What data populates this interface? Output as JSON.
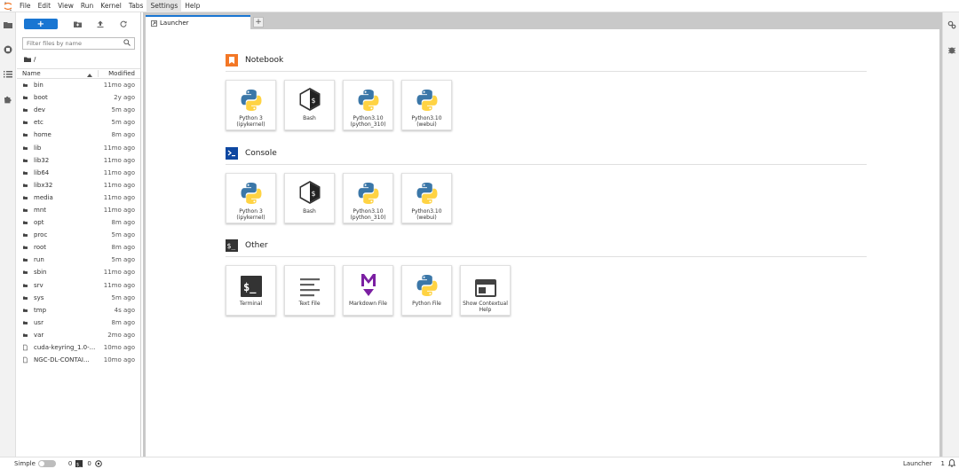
{
  "menubar": {
    "items": [
      "File",
      "Edit",
      "View",
      "Run",
      "Kernel",
      "Tabs",
      "Settings",
      "Help"
    ],
    "active": "Settings"
  },
  "filebrowser": {
    "new_label": "+",
    "filter_placeholder": "Filter files by name",
    "breadcrumb": "/",
    "col_name": "Name",
    "col_modified": "Modified",
    "items": [
      {
        "name": "bin",
        "modified": "11mo ago",
        "type": "folder"
      },
      {
        "name": "boot",
        "modified": "2y ago",
        "type": "folder"
      },
      {
        "name": "dev",
        "modified": "5m ago",
        "type": "folder"
      },
      {
        "name": "etc",
        "modified": "5m ago",
        "type": "folder"
      },
      {
        "name": "home",
        "modified": "8m ago",
        "type": "folder"
      },
      {
        "name": "lib",
        "modified": "11mo ago",
        "type": "folder"
      },
      {
        "name": "lib32",
        "modified": "11mo ago",
        "type": "folder"
      },
      {
        "name": "lib64",
        "modified": "11mo ago",
        "type": "folder"
      },
      {
        "name": "libx32",
        "modified": "11mo ago",
        "type": "folder"
      },
      {
        "name": "media",
        "modified": "11mo ago",
        "type": "folder"
      },
      {
        "name": "mnt",
        "modified": "11mo ago",
        "type": "folder"
      },
      {
        "name": "opt",
        "modified": "8m ago",
        "type": "folder"
      },
      {
        "name": "proc",
        "modified": "5m ago",
        "type": "folder"
      },
      {
        "name": "root",
        "modified": "8m ago",
        "type": "folder"
      },
      {
        "name": "run",
        "modified": "5m ago",
        "type": "folder"
      },
      {
        "name": "sbin",
        "modified": "11mo ago",
        "type": "folder"
      },
      {
        "name": "srv",
        "modified": "11mo ago",
        "type": "folder"
      },
      {
        "name": "sys",
        "modified": "5m ago",
        "type": "folder"
      },
      {
        "name": "tmp",
        "modified": "4s ago",
        "type": "folder"
      },
      {
        "name": "usr",
        "modified": "8m ago",
        "type": "folder"
      },
      {
        "name": "var",
        "modified": "2mo ago",
        "type": "folder"
      },
      {
        "name": "cuda-keyring_1.0-...",
        "modified": "10mo ago",
        "type": "file"
      },
      {
        "name": "NGC-DL-CONTAI...",
        "modified": "10mo ago",
        "type": "file"
      }
    ]
  },
  "tab": {
    "label": "Launcher",
    "add_label": "+"
  },
  "launcher": {
    "notebook": {
      "title": "Notebook",
      "cards": [
        {
          "label": "Python 3 (ipykernel)",
          "icon": "python-icon"
        },
        {
          "label": "Bash",
          "icon": "bash-icon"
        },
        {
          "label": "Python3.10 (python_310)",
          "icon": "python-icon"
        },
        {
          "label": "Python3.10 (webui)",
          "icon": "python-icon"
        }
      ]
    },
    "console": {
      "title": "Console",
      "cards": [
        {
          "label": "Python 3 (ipykernel)",
          "icon": "python-icon"
        },
        {
          "label": "Bash",
          "icon": "bash-icon"
        },
        {
          "label": "Python3.10 (python_310)",
          "icon": "python-icon"
        },
        {
          "label": "Python3.10 (webui)",
          "icon": "python-icon"
        }
      ]
    },
    "other": {
      "title": "Other",
      "cards": [
        {
          "label": "Terminal",
          "icon": "terminal-icon"
        },
        {
          "label": "Text File",
          "icon": "text-file-icon"
        },
        {
          "label": "Markdown File",
          "icon": "markdown-icon"
        },
        {
          "label": "Python File",
          "icon": "python-icon"
        },
        {
          "label": "Show Contextual Help",
          "icon": "contextual-help-icon"
        }
      ]
    }
  },
  "statusbar": {
    "mode_label": "Simple",
    "kernels_count": "0",
    "terminals_count": "0",
    "right_label": "Launcher",
    "right_count": "1"
  },
  "colors": {
    "accent": "#1976d2",
    "notebook_icon": "#f37726",
    "console_icon": "#0d47a1",
    "markdown": "#7b1fa2"
  }
}
